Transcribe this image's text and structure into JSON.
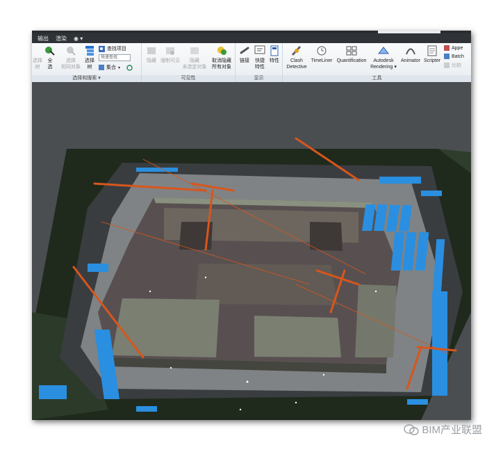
{
  "menu": {
    "items": [
      "输出",
      "渲染",
      "◉ ▾"
    ]
  },
  "ribbon": {
    "select_panel": {
      "label": "选择和搜索 ▾",
      "buttons": [
        {
          "label": "选择\n树",
          "state": "enabled"
        },
        {
          "label": "全\n选",
          "state": "enabled"
        },
        {
          "label": "选择\n相同对象",
          "state": "disabled"
        },
        {
          "label": "选择\n树",
          "state": "enabled"
        }
      ],
      "find_items": "查找项目",
      "quick_find_placeholder": "快速查找",
      "sets_value": "集合"
    },
    "visibility_panel": {
      "label": "可见性",
      "buttons": [
        {
          "label": "隐藏",
          "state": "disabled"
        },
        {
          "label": "强制可见",
          "state": "disabled"
        },
        {
          "label": "隐藏\n未选定对象",
          "state": "disabled"
        },
        {
          "label": "取消隐藏\n所有对象",
          "state": "enabled"
        }
      ]
    },
    "display_panel": {
      "label": "显示",
      "buttons": [
        {
          "label": "链接",
          "state": "enabled"
        },
        {
          "label": "快捷\n特性",
          "state": "enabled"
        },
        {
          "label": "特性",
          "state": "enabled"
        }
      ]
    },
    "tools_panel": {
      "label": "工具",
      "buttons": [
        {
          "label": "Clash\nDetective"
        },
        {
          "label": "TimeLiner"
        },
        {
          "label": "Quantification"
        },
        {
          "label": "Autodesk\nRendering ▾"
        },
        {
          "label": "Animator"
        },
        {
          "label": "Scripter"
        }
      ],
      "small": [
        "Appe",
        "Batch",
        "比较"
      ]
    }
  },
  "watermark": {
    "text": "BIM产业联盟",
    "icon": "wechat-icon"
  },
  "colors": {
    "ribbon_bg": "#eef1f4",
    "viewport_bg": "#4a4e51",
    "accent_blue": "#2a8fe0",
    "crane_orange": "#d8561c"
  }
}
